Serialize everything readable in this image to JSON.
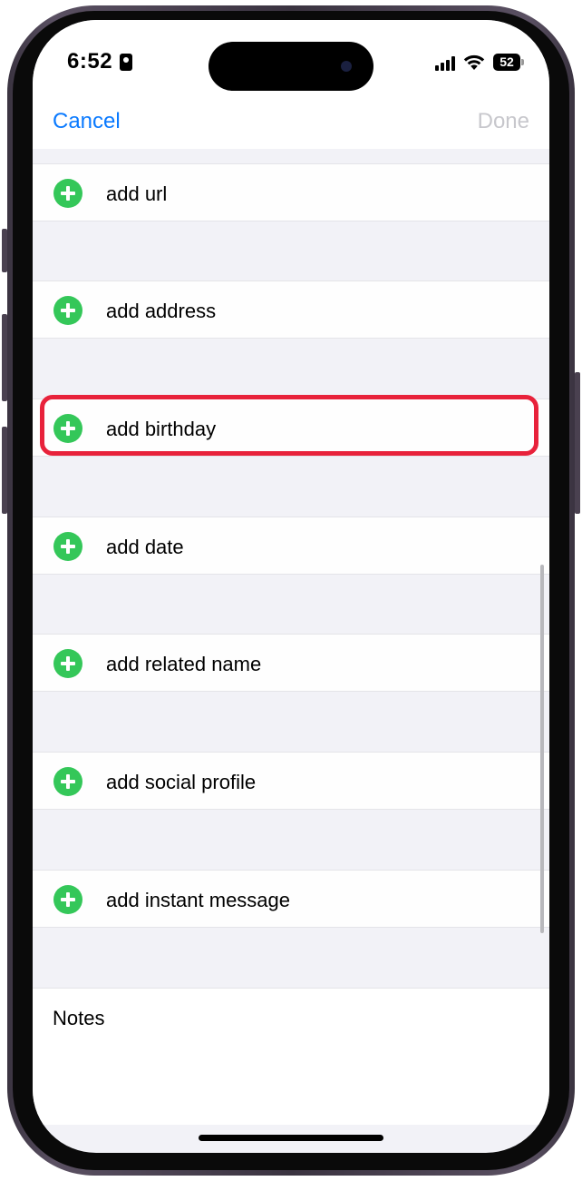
{
  "status_bar": {
    "time": "6:52",
    "battery": "52",
    "icons": [
      "id-badge-icon",
      "cellular-signal-icon",
      "wifi-icon",
      "battery-icon"
    ]
  },
  "nav": {
    "cancel_label": "Cancel",
    "done_label": "Done"
  },
  "fields": [
    {
      "label": "add url",
      "icon": "add-circle-icon"
    },
    {
      "label": "add address",
      "icon": "add-circle-icon"
    },
    {
      "label": "add birthday",
      "icon": "add-circle-icon",
      "highlighted": true
    },
    {
      "label": "add date",
      "icon": "add-circle-icon"
    },
    {
      "label": "add related name",
      "icon": "add-circle-icon"
    },
    {
      "label": "add social profile",
      "icon": "add-circle-icon"
    },
    {
      "label": "add instant message",
      "icon": "add-circle-icon"
    }
  ],
  "notes": {
    "label": "Notes"
  },
  "colors": {
    "accent": "#0a7aff",
    "add_green": "#34c759",
    "highlight_red": "#e8223b",
    "disabled": "#c7c7cc",
    "grouped_background": "#f2f2f7"
  }
}
